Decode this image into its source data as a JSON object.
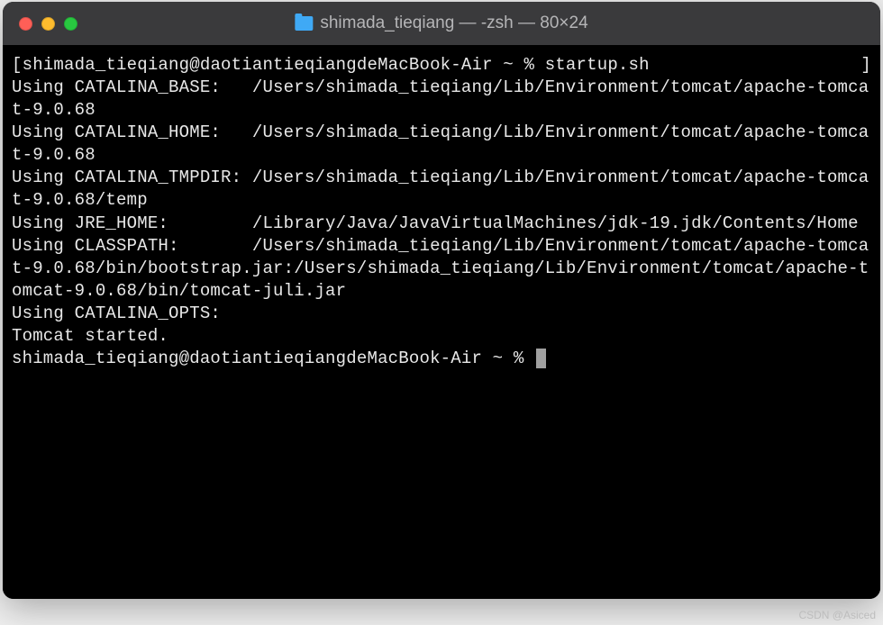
{
  "titlebar": {
    "title": "shimada_tieqiang — -zsh — 80×24"
  },
  "terminal": {
    "line1_left_bracket": "[",
    "line1_prompt": "shimada_tieqiang@daotiantieqiangdeMacBook-Air ~ % ",
    "line1_command": "startup.sh",
    "line1_right_bracket": "]",
    "output_block": "Using CATALINA_BASE:   /Users/shimada_tieqiang/Lib/Environment/tomcat/apache-tomcat-9.0.68\nUsing CATALINA_HOME:   /Users/shimada_tieqiang/Lib/Environment/tomcat/apache-tomcat-9.0.68\nUsing CATALINA_TMPDIR: /Users/shimada_tieqiang/Lib/Environment/tomcat/apache-tomcat-9.0.68/temp\nUsing JRE_HOME:        /Library/Java/JavaVirtualMachines/jdk-19.jdk/Contents/Home\nUsing CLASSPATH:       /Users/shimada_tieqiang/Lib/Environment/tomcat/apache-tomcat-9.0.68/bin/bootstrap.jar:/Users/shimada_tieqiang/Lib/Environment/tomcat/apache-tomcat-9.0.68/bin/tomcat-juli.jar\nUsing CATALINA_OPTS:\nTomcat started.",
    "line_last_prompt": "shimada_tieqiang@daotiantieqiangdeMacBook-Air ~ % "
  },
  "watermark": "CSDN @Asiced"
}
